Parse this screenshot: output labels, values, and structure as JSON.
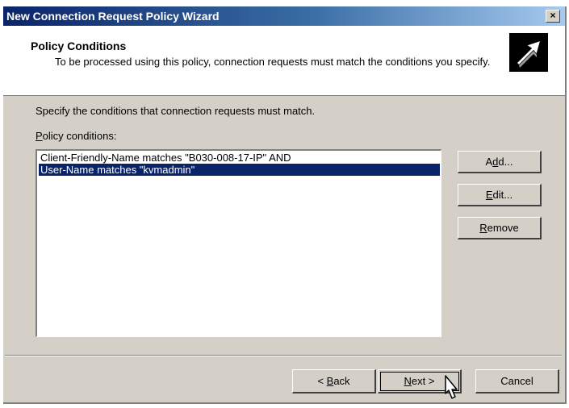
{
  "window": {
    "title": "New Connection Request Policy Wizard",
    "close_label": "×"
  },
  "header": {
    "title": "Policy Conditions",
    "description": "To be processed using this policy, connection requests must match the conditions you specify.",
    "icon": "wizard-arrow-icon"
  },
  "body": {
    "intro": "Specify the conditions that connection requests must match.",
    "conditions_label_hotkey": "P",
    "conditions_label_rest": "olicy conditions:"
  },
  "conditions": [
    {
      "text": "Client-Friendly-Name matches \"B030-008-17-IP\"  AND",
      "selected": false
    },
    {
      "text": "User-Name matches \"kvmadmin\"",
      "selected": true
    }
  ],
  "side_buttons": {
    "add": {
      "pre": "A",
      "hotkey": "d",
      "post": "d..."
    },
    "edit": {
      "pre": "",
      "hotkey": "E",
      "post": "dit..."
    },
    "remove": {
      "pre": "",
      "hotkey": "R",
      "post": "emove"
    }
  },
  "nav_buttons": {
    "back": {
      "pre": "< ",
      "hotkey": "B",
      "post": "ack"
    },
    "next": {
      "pre": "",
      "hotkey": "N",
      "post": "ext >"
    },
    "cancel": "Cancel"
  }
}
